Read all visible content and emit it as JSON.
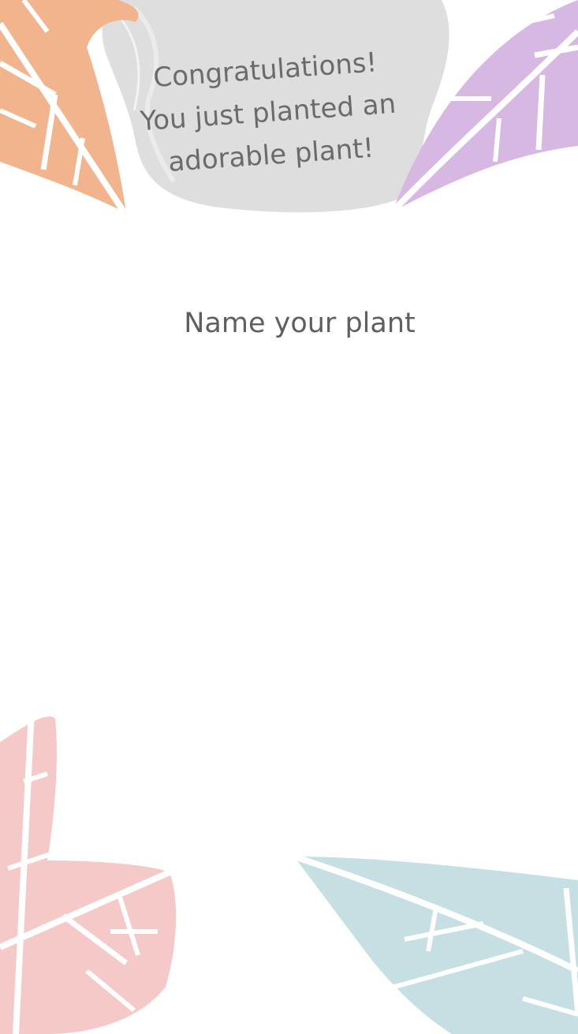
{
  "heading": {
    "line1": "Congratulations!",
    "line2": "You just planted an",
    "line3": "adorable plant!"
  },
  "name_prompt": {
    "label": "Name your plant"
  },
  "decorations": {
    "leaf_top_left": {
      "icon": "orange-leaf-icon",
      "color": "#f2b48c"
    },
    "leaf_top_right": {
      "icon": "purple-leaf-icon",
      "color": "#d7b8e2"
    },
    "leaf_bottom_left": {
      "icon": "pink-leaf-icon",
      "color": "#f6c9c9"
    },
    "leaf_bottom_right": {
      "icon": "blue-leaf-icon",
      "color": "#c5dfe3"
    },
    "banner_color": "#dcdcdc"
  }
}
